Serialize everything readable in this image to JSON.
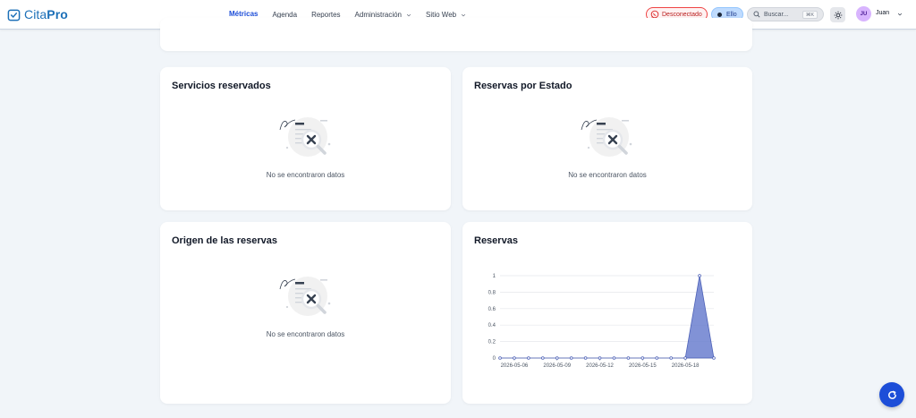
{
  "app": {
    "name_a": "Cita",
    "name_b": "Pro"
  },
  "nav": [
    {
      "label": "Métricas",
      "active": true,
      "dropdown": false
    },
    {
      "label": "Agenda",
      "active": false,
      "dropdown": false
    },
    {
      "label": "Reportes",
      "active": false,
      "dropdown": false
    },
    {
      "label": "Administración",
      "active": false,
      "dropdown": true
    },
    {
      "label": "Sitio Web",
      "active": false,
      "dropdown": true
    }
  ],
  "header": {
    "whatsapp_status": "Desconectado",
    "account": "Ello",
    "search_placeholder": "Buscar...",
    "search_shortcut": "⌘K",
    "user_initials": "JU",
    "user_name": "Juan"
  },
  "cards": {
    "services": {
      "title": "Servicios reservados",
      "empty": "No se encontraron datos"
    },
    "status": {
      "title": "Reservas por Estado",
      "empty": "No se encontraron datos"
    },
    "origin": {
      "title": "Origen de las reservas",
      "empty": "No se encontraron datos"
    },
    "reservations": {
      "title": "Reservas"
    }
  },
  "colors": {
    "accent": "#1d4ed8",
    "series_fill": "#6b7fcf",
    "series_stroke": "#4f63b8"
  },
  "chart_data": {
    "type": "area",
    "title": "Reservas",
    "xlabel": "",
    "ylabel": "",
    "ylim": [
      0,
      1
    ],
    "yticks": [
      0,
      0.2,
      0.4,
      0.6,
      0.8,
      1
    ],
    "ytick_labels": [
      "0",
      "0.2",
      "0.4",
      "0.6",
      "0.8",
      "1"
    ],
    "xtick_labels": [
      "2026-05-06",
      "2026-05-09",
      "2026-05-12",
      "2026-05-15",
      "2026-05-18"
    ],
    "x": [
      "2026-05-05",
      "2026-05-06",
      "2026-05-07",
      "2026-05-08",
      "2026-05-09",
      "2026-05-10",
      "2026-05-11",
      "2026-05-12",
      "2026-05-13",
      "2026-05-14",
      "2026-05-15",
      "2026-05-16",
      "2026-05-17",
      "2026-05-18",
      "2026-05-19",
      "2026-05-20"
    ],
    "values": [
      0,
      0,
      0,
      0,
      0,
      0,
      0,
      0,
      0,
      0,
      0,
      0,
      0,
      0,
      1,
      0
    ],
    "grid": true
  }
}
